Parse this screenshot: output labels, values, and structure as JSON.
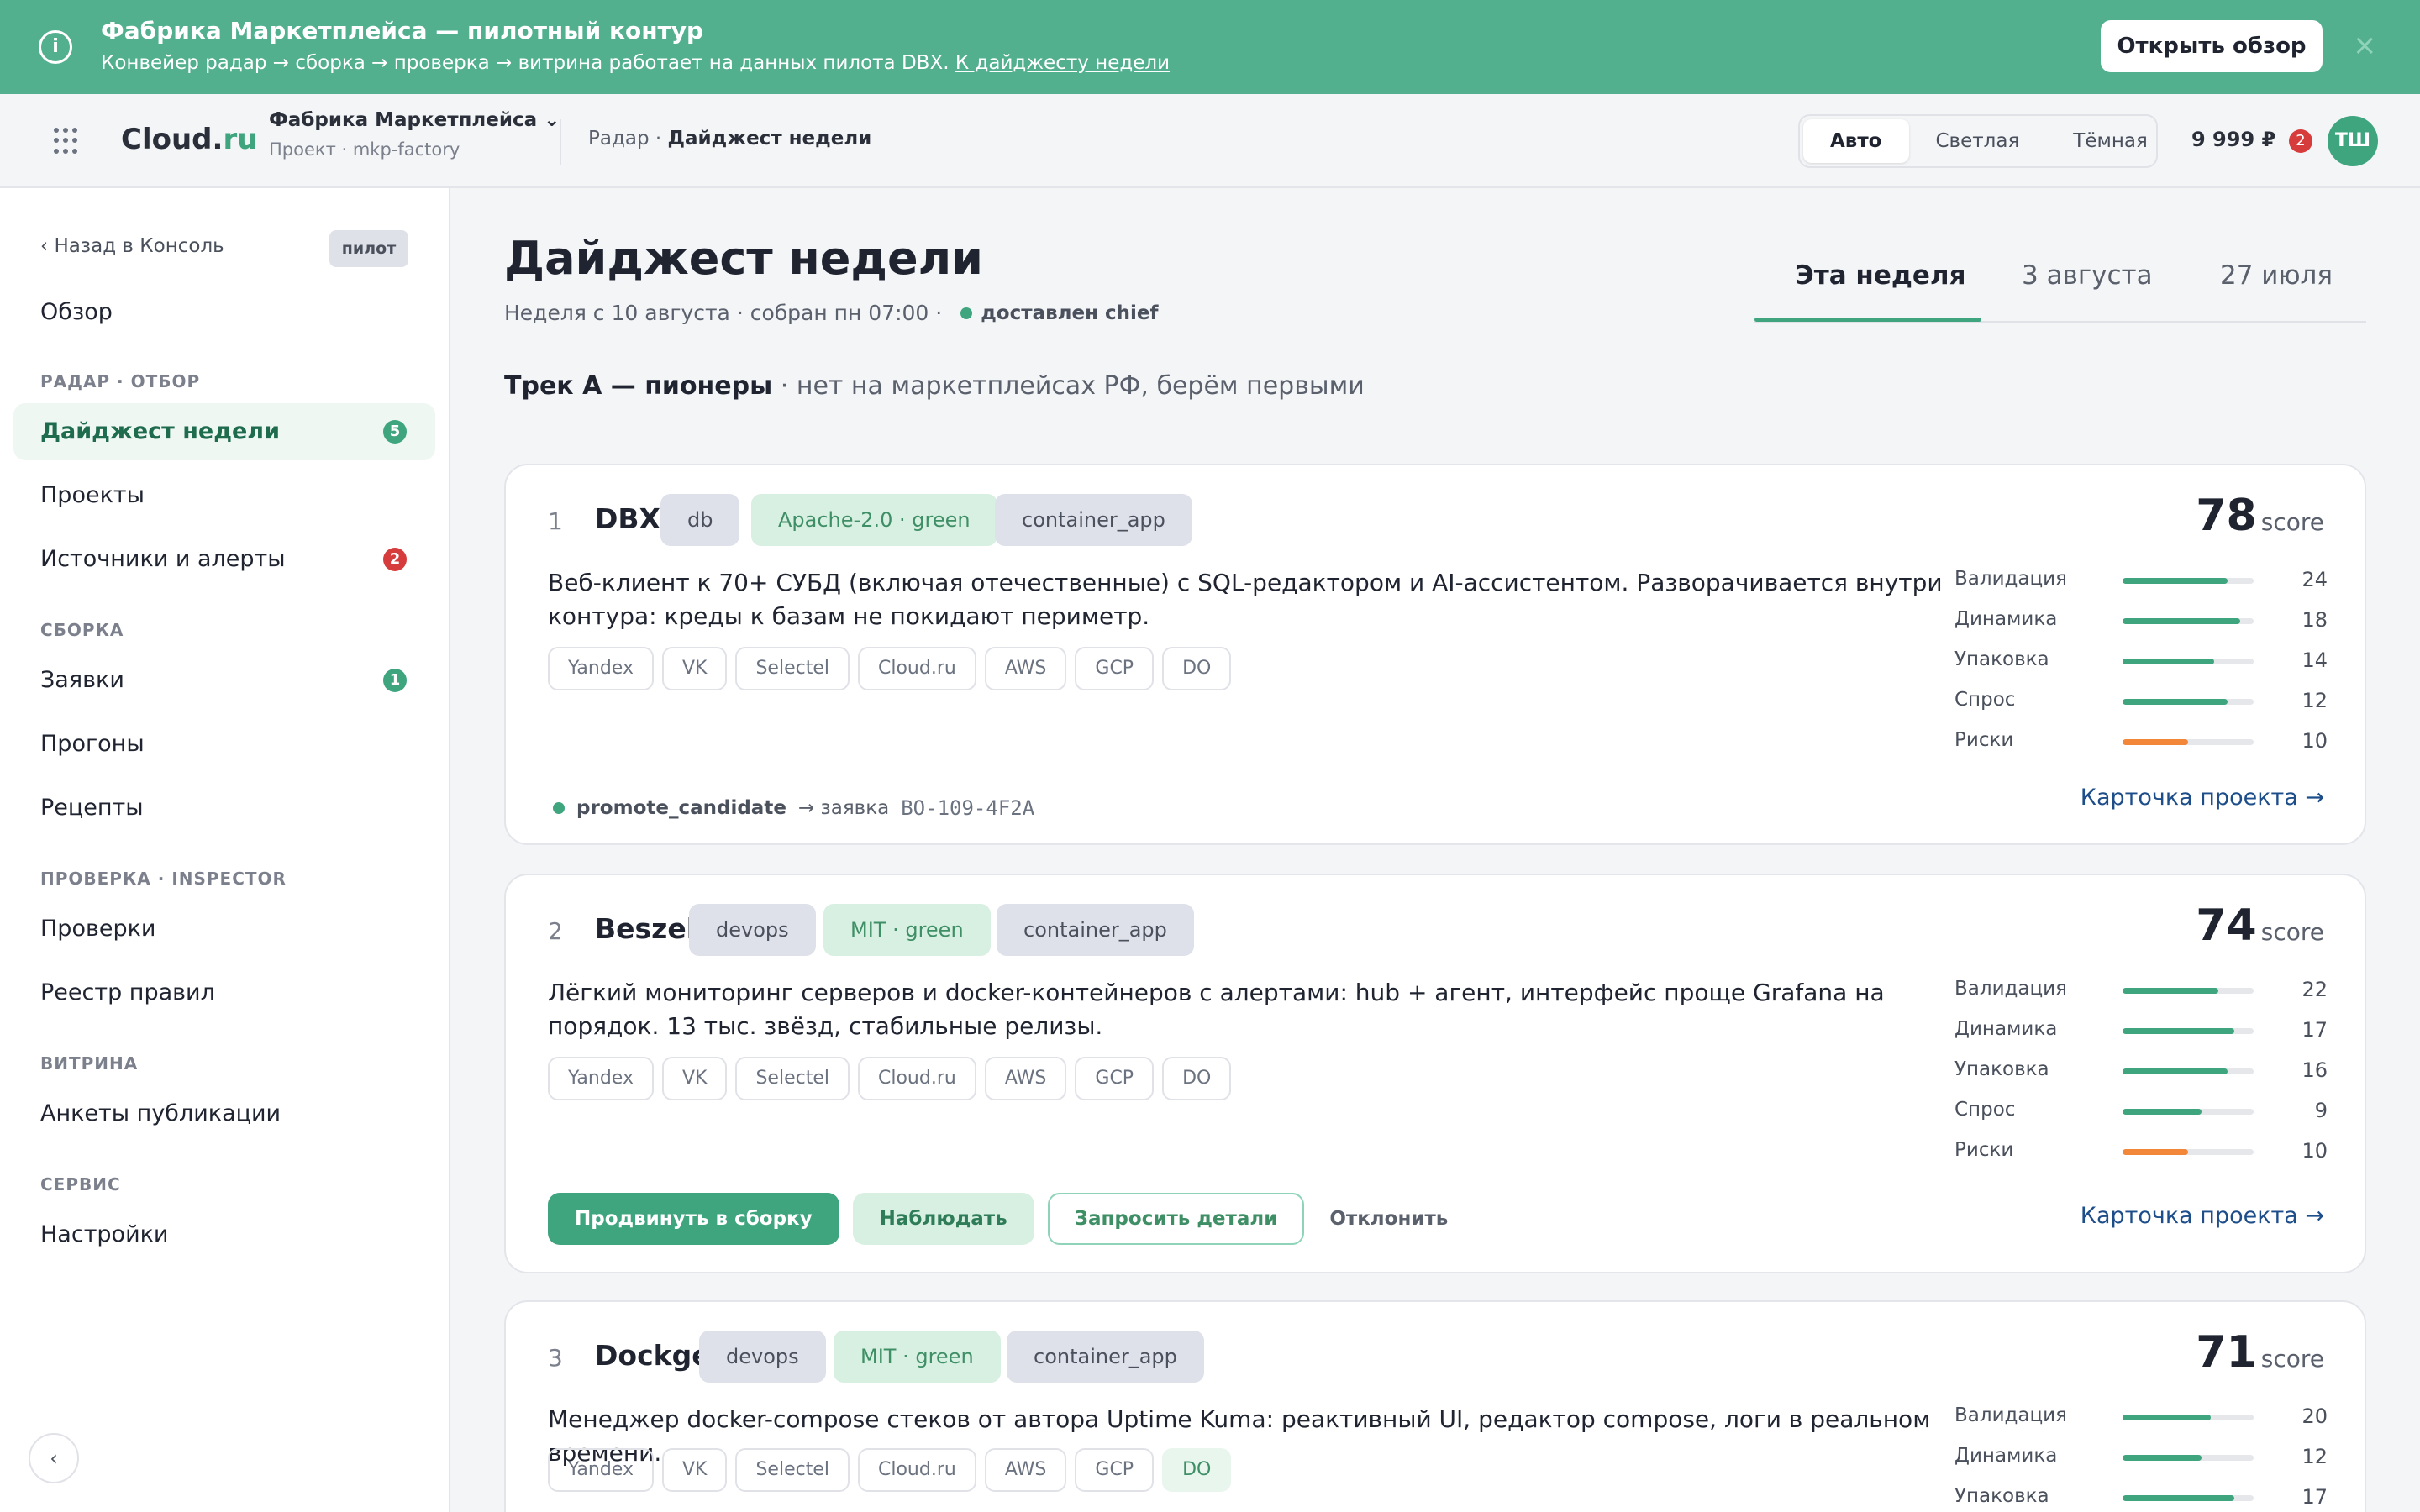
{
  "banner": {
    "title": "Фабрика Маркетплейса — пилотный контур",
    "subtitle": "Конвейер радар → сборка → проверка → витрина работает на данных пилота DBX.",
    "link": "К дайджесту недели",
    "button": "Открыть обзор",
    "close": "×"
  },
  "header": {
    "logo_main": "Cloud.",
    "logo_ru": "ru",
    "project_name": "Фабрика Маркетплейса ⌄",
    "project_id": "Проект · mkp-factory",
    "breadcrumb_parent": "Радар · ",
    "breadcrumb_current": "Дайджест недели",
    "theme_options": [
      "Авто",
      "Светлая",
      "Тёмная"
    ],
    "balance": "9 999 ₽",
    "notifications": "2",
    "avatar": "ТШ"
  },
  "sidebar": {
    "back": "‹  Назад в Консоль",
    "pilot_badge": "пилот",
    "overview": "Обзор",
    "section_radar": "РАДАР · ОТБОР",
    "digest": "Дайджест недели",
    "digest_count": "5",
    "projects": "Проекты",
    "sources": "Источники и алерты",
    "sources_count": "2",
    "section_build": "СБОРКА",
    "requests": "Заявки",
    "requests_count": "1",
    "runs": "Прогоны",
    "recipes": "Рецепты",
    "section_check": "ПРОВЕРКА · INSPECTOR",
    "checks": "Проверки",
    "rules": "Реестр правил",
    "section_showcase": "ВИТРИНА",
    "forms": "Анкеты публикации",
    "section_service": "СЕРВИС",
    "settings": "Настройки",
    "collapse": "‹"
  },
  "main": {
    "title": "Дайджест недели",
    "meta": "Неделя с 10 августа · собран пн 07:00 ·",
    "delivered": "доставлен chief",
    "tabs": [
      "Эта неделя",
      "3 августа",
      "27 июля"
    ],
    "track_title": "Трек А — пионеры",
    "track_desc": " · нет на маркетплейсах РФ, берём первыми"
  },
  "cards": [
    {
      "rank": "1",
      "name": "DBX",
      "tags": [
        "db",
        "Apache-2.0 · green",
        "container_app"
      ],
      "description": "Веб-клиент к 70+ СУБД (включая отечественные) с SQL-редактором и AI-ассистентом. Разворачивается внутри контура: креды к базам не покидают периметр.",
      "clouds": [
        "Yandex",
        "VK",
        "Selectel",
        "Cloud.ru",
        "AWS",
        "GCP",
        "DO"
      ],
      "score": "78",
      "score_label": "score",
      "metrics": [
        {
          "name": "Валидация",
          "value": "24",
          "fill": 0.8
        },
        {
          "name": "Динамика",
          "value": "18",
          "fill": 0.9
        },
        {
          "name": "Упаковка",
          "value": "14",
          "fill": 0.7
        },
        {
          "name": "Спрос",
          "value": "12",
          "fill": 0.8
        },
        {
          "name": "Риски",
          "value": "10",
          "fill": 0.5
        }
      ],
      "status": "promote_candidate",
      "status_arrow": "→ заявка",
      "status_id": "BO-109-4F2A",
      "link": "Карточка проекта →"
    },
    {
      "rank": "2",
      "name": "Beszel",
      "tags": [
        "devops",
        "MIT · green",
        "container_app"
      ],
      "description": "Лёгкий мониторинг серверов и docker-контейнеров с алертами: hub + агент, интерфейс проще Grafana на порядок. 13 тыс. звёзд, стабильные релизы.",
      "clouds": [
        "Yandex",
        "VK",
        "Selectel",
        "Cloud.ru",
        "AWS",
        "GCP",
        "DO"
      ],
      "score": "74",
      "score_label": "score",
      "metrics": [
        {
          "name": "Валидация",
          "value": "22",
          "fill": 0.73
        },
        {
          "name": "Динамика",
          "value": "17",
          "fill": 0.85
        },
        {
          "name": "Упаковка",
          "value": "16",
          "fill": 0.8
        },
        {
          "name": "Спрос",
          "value": "9",
          "fill": 0.6
        },
        {
          "name": "Риски",
          "value": "10",
          "fill": 0.5
        }
      ],
      "actions": [
        "Продвинуть в сборку",
        "Наблюдать",
        "Запросить детали",
        "Отклонить"
      ],
      "link": "Карточка проекта →"
    },
    {
      "rank": "3",
      "name": "Dockge",
      "tags": [
        "devops",
        "MIT · green",
        "container_app"
      ],
      "description": "Менеджер docker-compose стеков от автора Uptime Kuma: реактивный UI, редактор compose, логи в реальном времени.",
      "clouds": [
        "Yandex",
        "VK",
        "Selectel",
        "Cloud.ru",
        "AWS",
        "GCP",
        "DO"
      ],
      "score": "71",
      "score_label": "score",
      "metrics": [
        {
          "name": "Валидация",
          "value": "20",
          "fill": 0.67
        },
        {
          "name": "Динамика",
          "value": "12",
          "fill": 0.6
        },
        {
          "name": "Упаковка",
          "value": "17",
          "fill": 0.85
        }
      ]
    }
  ]
}
